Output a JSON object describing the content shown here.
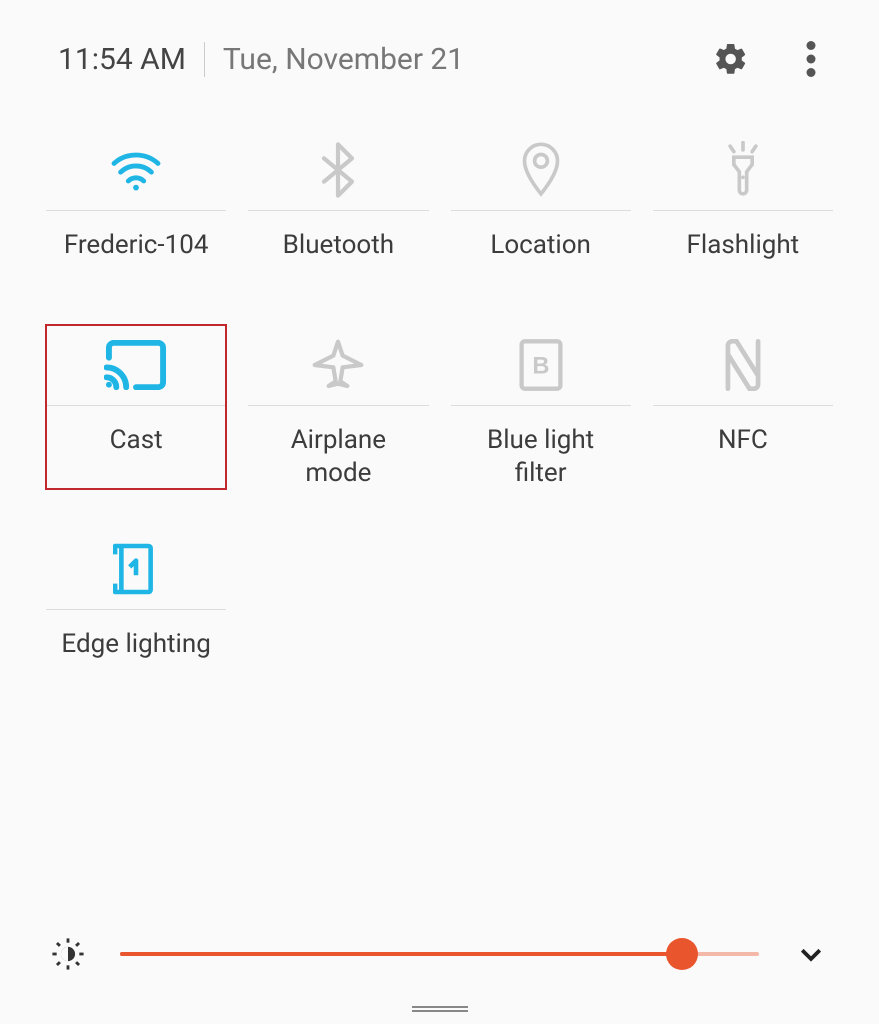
{
  "header": {
    "time": "11:54 AM",
    "date": "Tue, November 21"
  },
  "tiles": [
    {
      "id": "wifi",
      "label": "Frederic-104",
      "icon": "wifi-icon",
      "active": true,
      "highlight": false
    },
    {
      "id": "bluetooth",
      "label": "Bluetooth",
      "icon": "bluetooth-icon",
      "active": false,
      "highlight": false
    },
    {
      "id": "location",
      "label": "Location",
      "icon": "location-icon",
      "active": false,
      "highlight": false
    },
    {
      "id": "flashlight",
      "label": "Flashlight",
      "icon": "flashlight-icon",
      "active": false,
      "highlight": false
    },
    {
      "id": "cast",
      "label": "Cast",
      "icon": "cast-icon",
      "active": true,
      "highlight": true
    },
    {
      "id": "airplane",
      "label": "Airplane mode",
      "icon": "airplane-icon",
      "active": false,
      "highlight": false
    },
    {
      "id": "bluelight",
      "label": "Blue light filter",
      "icon": "bluelight-icon",
      "active": false,
      "highlight": false
    },
    {
      "id": "nfc",
      "label": "NFC",
      "icon": "nfc-icon",
      "active": false,
      "highlight": false
    },
    {
      "id": "edgelighting",
      "label": "Edge lighting",
      "icon": "edgelighting-icon",
      "active": true,
      "highlight": false
    }
  ],
  "brightness": {
    "value": 88,
    "min": 0,
    "max": 100
  },
  "colors": {
    "active": "#1fb6e6",
    "inactive": "#c9c9c9",
    "accent": "#e9552d",
    "highlight_border": "#c1282d"
  }
}
